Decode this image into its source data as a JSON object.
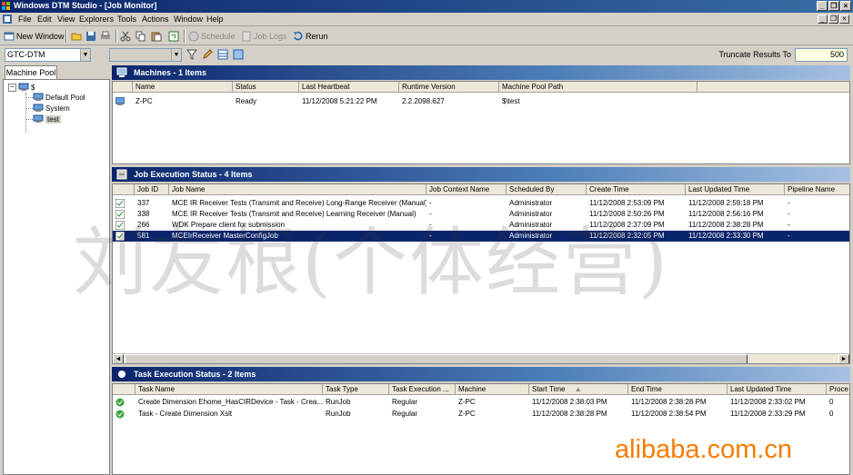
{
  "window": {
    "title": "Windows DTM Studio - [Job Monitor]"
  },
  "menu": [
    "File",
    "Edit",
    "View",
    "Explorers",
    "Tools",
    "Actions",
    "Window",
    "Help"
  ],
  "toolbar": {
    "new_window": "New Window",
    "schedule": "Schedule",
    "job_logs": "Job Logs",
    "rerun": "Rerun"
  },
  "filter": {
    "controller": "GTC-DTM",
    "truncate_label": "Truncate Results To",
    "truncate_value": "500"
  },
  "left_pane": {
    "tab": "Machine Pool",
    "tree": [
      {
        "label": "$",
        "level": 0
      },
      {
        "label": "Default Pool",
        "level": 1
      },
      {
        "label": "System",
        "level": 1
      },
      {
        "label": "test",
        "level": 1,
        "selected": true
      }
    ]
  },
  "machines": {
    "title": "Machines - 1 Items",
    "columns": [
      "Name",
      "Status",
      "Last Heartbeat",
      "Runtime Version",
      "Machine Pool Path"
    ],
    "rows": [
      [
        "Z-PC",
        "Ready",
        "11/12/2008 5:21:22 PM",
        "2.2.2098.627",
        "$\\test"
      ]
    ]
  },
  "jobs": {
    "title": "Job Execution Status - 4 Items",
    "columns": [
      "Job ID",
      "Job Name",
      "Job Context Name",
      "Scheduled By",
      "Create Time",
      "Last Updated Time",
      "Pipeline Name"
    ],
    "rows": [
      [
        "337",
        "MCE IR Receiver Tests (Transmit and Receive) Long-Range Receiver (Manual)",
        "-",
        "Administrator",
        "11/12/2008 2:53:09 PM",
        "11/12/2008 2:59:18 PM",
        "-"
      ],
      [
        "338",
        "MCE IR Receiver Tests (Transmit and Receive) Learning Receiver (Manual)",
        "-",
        "Administrator",
        "11/12/2008 2:50:26 PM",
        "11/12/2008 2:56:16 PM",
        "-"
      ],
      [
        "266",
        "WDK Prepare client for submission",
        "-",
        "Administrator",
        "11/12/2008 2:37:09 PM",
        "11/12/2008 2:38:28 PM",
        "-"
      ],
      [
        "581",
        "MCEIrReceiver MasterConfigJob",
        "-",
        "Administrator",
        "11/12/2008 2:32:05 PM",
        "11/12/2008 2:33:30 PM",
        "-"
      ]
    ],
    "selected_row": 3
  },
  "tasks": {
    "title": "Task Execution Status - 2 Items",
    "columns": [
      "Task Name",
      "Task Type",
      "Task Execution ...",
      "Machine",
      "Start Time",
      "End Time",
      "Last Updated Time",
      "Proce"
    ],
    "rows": [
      [
        "Create Dimension Ehome_HasCIRDevice - Task - Crea...",
        "RunJob",
        "Regular",
        "Z-PC",
        "11/12/2008 2:38:03 PM",
        "11/12/2008 2:38:28 PM",
        "11/12/2008 2:33:02 PM",
        "0"
      ],
      [
        "Task - Create Dimension Xslt",
        "RunJob",
        "Regular",
        "Z-PC",
        "11/12/2008 2:38:28 PM",
        "11/12/2008 2:38:54 PM",
        "11/12/2008 2:33:29 PM",
        "0"
      ]
    ]
  },
  "overlay": {
    "watermark": "刘友根(个体经营)",
    "site": "alibaba.com.cn"
  }
}
